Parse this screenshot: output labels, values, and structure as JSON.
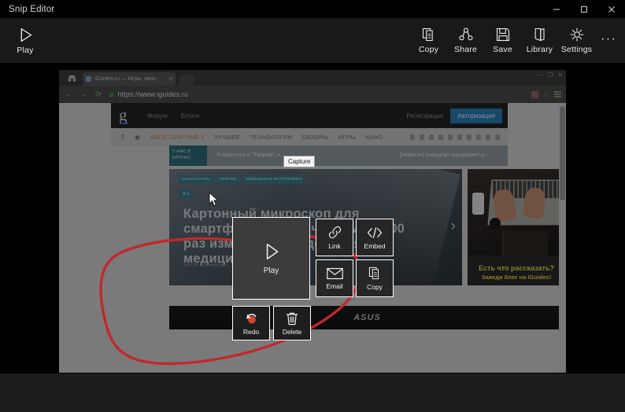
{
  "window": {
    "title": "Snip Editor",
    "controls": [
      {
        "name": "minimize",
        "glyph": "minimize-icon"
      },
      {
        "name": "maximize",
        "glyph": "maximize-icon"
      },
      {
        "name": "close",
        "glyph": "close-icon"
      }
    ]
  },
  "toolbar": {
    "play": {
      "label": "Play",
      "icon": "play-icon"
    },
    "items": [
      {
        "label": "Copy",
        "icon": "copy-icon"
      },
      {
        "label": "Share",
        "icon": "share-icon"
      },
      {
        "label": "Save",
        "icon": "save-icon"
      },
      {
        "label": "Library",
        "icon": "library-icon"
      },
      {
        "label": "Settings",
        "icon": "gear-icon"
      }
    ],
    "more": "···"
  },
  "popup": {
    "play": {
      "label": "Play",
      "icon": "play-icon"
    },
    "tiles": [
      {
        "label": "Link",
        "icon": "link-icon"
      },
      {
        "label": "Embed",
        "icon": "embed-icon"
      },
      {
        "label": "Email",
        "icon": "email-icon"
      },
      {
        "label": "Copy",
        "icon": "copy-icon"
      }
    ],
    "bottom": [
      {
        "label": "Redo",
        "icon": "redo-icon"
      },
      {
        "label": "Delete",
        "icon": "trash-icon"
      }
    ]
  },
  "screenshot": {
    "browser": {
      "tab_title": "iGuides.ru — Игры, кино",
      "tab_close": "×",
      "url": "https://www.iguides.ru",
      "nav": {
        "back": "←",
        "forward": "→",
        "reload": "⟳"
      },
      "window_controls": [
        "—",
        "❐",
        "✕"
      ]
    },
    "site": {
      "logo": "g",
      "header_links": [
        "Форум",
        "Блоги"
      ],
      "register": "Регистрация",
      "login": "Авторизация",
      "nav_items": [
        {
          "label": "ASUS ZENFONE 2",
          "accent": true
        },
        {
          "label": "ЛУЧШЕЕ",
          "accent": false
        },
        {
          "label": "ТЕХНОЛОГИИ",
          "accent": false
        },
        {
          "label": "ОБЗОРЫ",
          "accent": false
        },
        {
          "label": "ИГРЫ",
          "accent": false
        },
        {
          "label": "КИНО",
          "accent": false
        }
      ],
      "blogstrip": {
        "tag": "У НАС В БЛОГАХ:",
        "item1": "Я вернулся и \"Разрыв\", ч...",
        "item2": "[Новости] Instagram расширяет р..."
      },
      "hero": {
        "tags": [
          "АКСЕССУАРЫ",
          "ПРОЧЕЕ",
          "МОБИЛЬНАЯ ФОТОГРАФИЯ"
        ],
        "comments": "✉ 2",
        "title": "Картонный микроскоп для смартфона с увеличением в 2000 раз изменит исследования и медицину",
        "byline": "АРТУР СОТНИКОВ — 28 АВГУСТА 2015 17:55",
        "next_arrow": "›"
      },
      "aside": {
        "line1": "Есть что рассказать?",
        "line2": "Заведи блог на iGuides!"
      },
      "banner": "ASUS"
    },
    "capture_tooltip": "Capture"
  },
  "colors": {
    "accent_blue": "#2a7fb5",
    "annotation_red": "#c0282d",
    "teal": "#2e6b78",
    "yellow": "#f2d64a",
    "app_bg": "#1c1c1c",
    "toolbar_bg": "#191919"
  }
}
